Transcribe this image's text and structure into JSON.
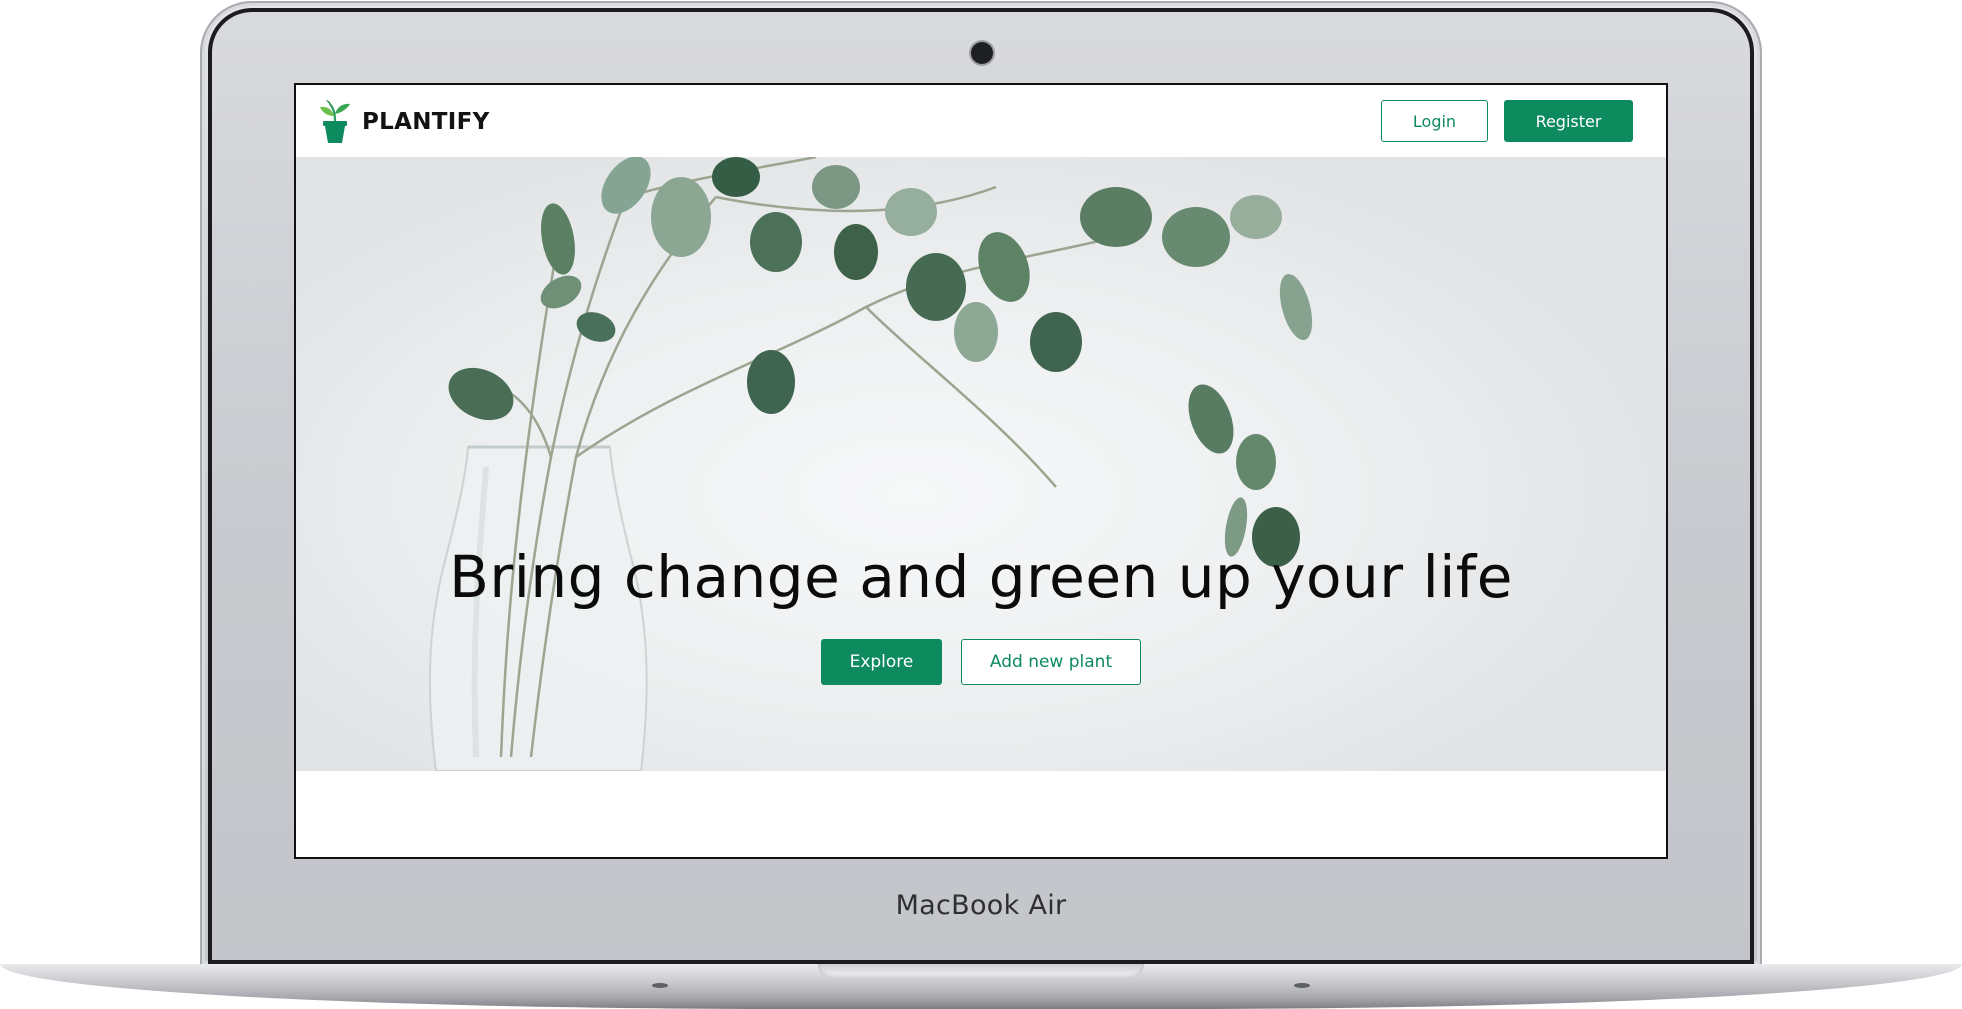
{
  "device": {
    "label": "MacBook Air"
  },
  "navbar": {
    "brand": "PLANTIFY",
    "login_label": "Login",
    "register_label": "Register"
  },
  "hero": {
    "title": "Bring change and green up your life",
    "explore_label": "Explore",
    "add_plant_label": "Add new plant"
  },
  "icons": {
    "logo": "potted-plant-icon"
  },
  "colors": {
    "accent": "#0e8a5f",
    "title": "#0b0b0b",
    "background": "#ffffff"
  }
}
